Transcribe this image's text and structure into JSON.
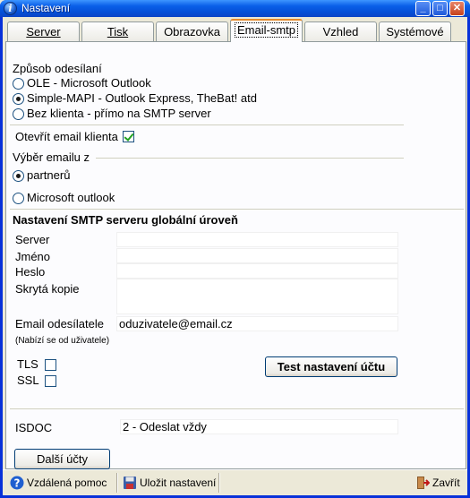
{
  "window": {
    "title": "Nastavení"
  },
  "tabs": [
    {
      "label": "Server"
    },
    {
      "label": "Tisk"
    },
    {
      "label": "Obrazovka"
    },
    {
      "label": "Email-smtp",
      "active": true
    },
    {
      "label": "Vzhled"
    },
    {
      "label": "Systémové"
    }
  ],
  "send_method": {
    "heading": "Způsob odesílaní",
    "options": [
      {
        "label": "OLE - Microsoft Outlook",
        "selected": false
      },
      {
        "label": "Simple-MAPI - Outlook Express, TheBat! atd",
        "selected": true
      },
      {
        "label": "Bez klienta - přímo na SMTP server",
        "selected": false
      }
    ]
  },
  "open_client": {
    "label": "Otevřít email klienta",
    "checked": true
  },
  "email_choice": {
    "heading": "Výběr emailu z",
    "options": [
      {
        "label": "partnerů",
        "selected": true
      },
      {
        "label": "Microsoft outlook",
        "selected": false
      }
    ]
  },
  "smtp": {
    "heading": "Nastavení SMTP serveru globální úroveň",
    "server_label": "Server",
    "server_value": "",
    "name_label": "Jméno",
    "name_value": "",
    "password_label": "Heslo",
    "password_value": "",
    "bcc_label": "Skrytá kopie",
    "bcc_value": "",
    "sender_label": "Email odesílatele",
    "sender_value": "oduzivatele@email.cz",
    "sender_hint": "(Nabízí se od uživatele)",
    "tls_label": "TLS",
    "tls_checked": false,
    "ssl_label": "SSL",
    "ssl_checked": false,
    "test_button": "Test nastavení účtu"
  },
  "isdoc": {
    "label": "ISDOC",
    "value": "2 - Odeslat vždy"
  },
  "more_accounts_button": "Další účty",
  "toolbar": {
    "remote_help": "Vzdálená pomoc",
    "save": "Uložit nastavení",
    "close": "Zavřít"
  }
}
